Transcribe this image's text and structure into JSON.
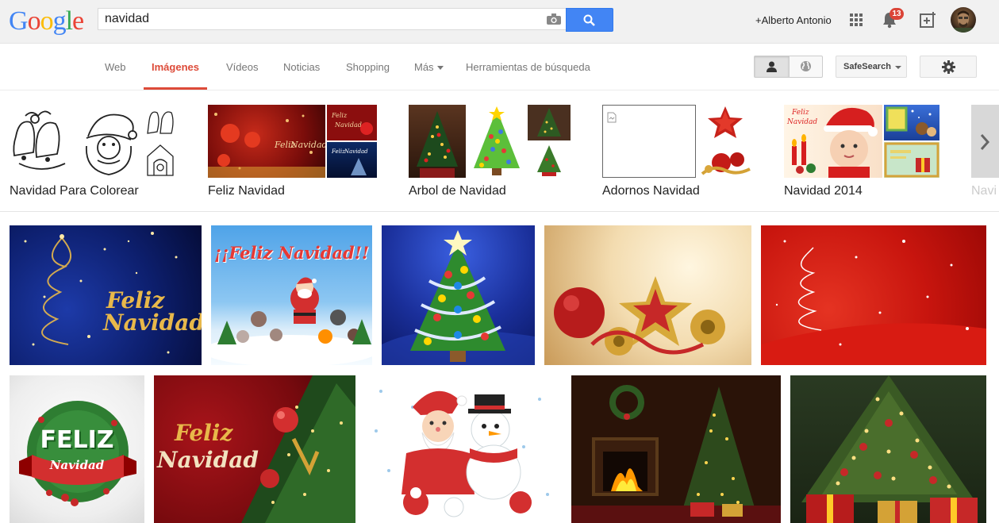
{
  "header": {
    "logo": [
      "G",
      "o",
      "o",
      "g",
      "l",
      "e"
    ],
    "logo_colors": [
      "#4285f4",
      "#ea4335",
      "#fbbc05",
      "#4285f4",
      "#34a853",
      "#ea4335"
    ],
    "search_value": "navidad",
    "user_name": "+Alberto Antonio",
    "notification_count": "13",
    "icons": [
      "camera-icon",
      "search-icon",
      "apps-grid-icon",
      "bell-icon",
      "share-plus-icon",
      "avatar"
    ]
  },
  "nav": {
    "tabs": [
      {
        "label": "Web",
        "active": false
      },
      {
        "label": "Imágenes",
        "active": true
      },
      {
        "label": "Vídeos",
        "active": false
      },
      {
        "label": "Noticias",
        "active": false
      },
      {
        "label": "Shopping",
        "active": false
      },
      {
        "label": "Más",
        "active": false
      },
      {
        "label": "Herramientas de búsqueda",
        "active": false
      }
    ],
    "safesearch_label": "SafeSearch",
    "accent_color": "#dd4b39"
  },
  "related": [
    {
      "label": "Navidad Para Colorear"
    },
    {
      "label": "Feliz Navidad"
    },
    {
      "label": "Arbol de Navidad"
    },
    {
      "label": "Adornos Navidad"
    },
    {
      "label": "Navidad 2014"
    },
    {
      "label": "Navi"
    }
  ],
  "results": {
    "row1": [
      {
        "caption_1": "Feliz",
        "caption_2": "Navidad"
      },
      {
        "caption": "¡¡Feliz Navidad!!"
      },
      {},
      {},
      {}
    ],
    "row2": [
      {
        "caption_1": "FELIZ",
        "caption_2": "Navidad"
      },
      {
        "caption_1": "Feliz",
        "caption_2": "Navidad"
      },
      {},
      {},
      {}
    ]
  },
  "related_thumb_texts": {
    "feliz_1": "Feliz",
    "navidad_1": "Navidad",
    "feliz_2": "Feliz",
    "navidad_2": "Navidad",
    "feliz_3": "Feliz",
    "navidad_3": "Navidad",
    "feliz_4": "Feliz",
    "navidad_4": "Navidad"
  }
}
